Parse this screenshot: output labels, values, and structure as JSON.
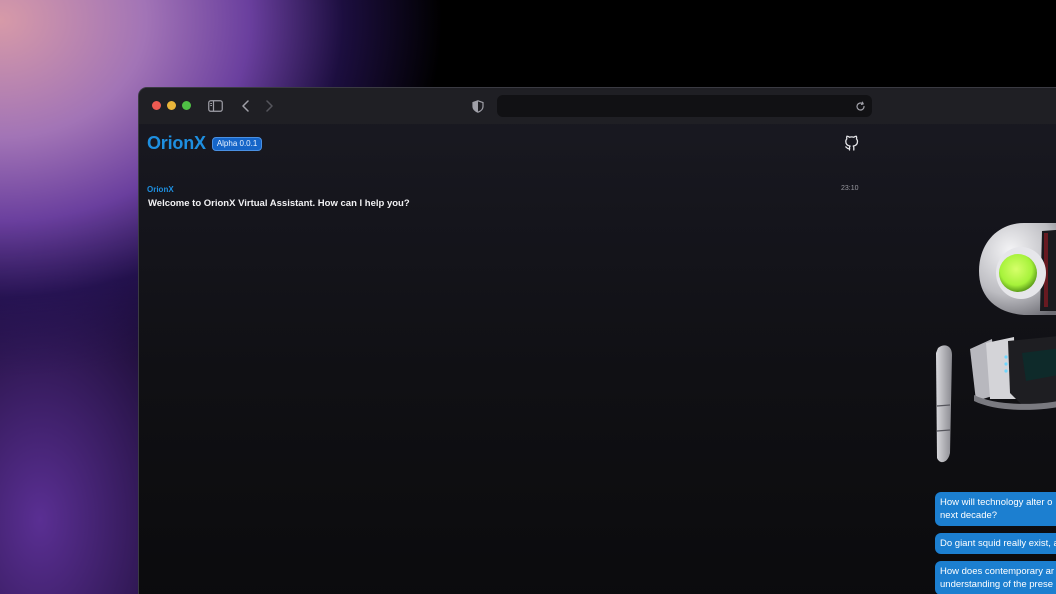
{
  "app": {
    "title": "OrionX",
    "version_badge": "Alpha 0.0.1"
  },
  "icons": {
    "sidebar": "sidebar-toggle-icon",
    "back": "chevron-left-icon",
    "forward": "chevron-right-icon",
    "shield": "privacy-shield-icon",
    "reload": "reload-icon",
    "github": "github-icon"
  },
  "chat": {
    "messages": [
      {
        "sender": "OrionX",
        "time": "23:10",
        "text": "Welcome to OrionX Virtual Assistant. How can I help you?"
      }
    ]
  },
  "suggestions": [
    {
      "line1": "How will technology alter o",
      "line2": "next decade?"
    },
    {
      "line1": "Do giant squid really exist, a"
    },
    {
      "line1": "How does contemporary ar",
      "line2": "understanding of the prese"
    }
  ],
  "colors": {
    "accent": "#1e8fe0",
    "chip": "#1c7fd0",
    "badge": "#1565c8",
    "robot_eye": "#a6f23a"
  }
}
